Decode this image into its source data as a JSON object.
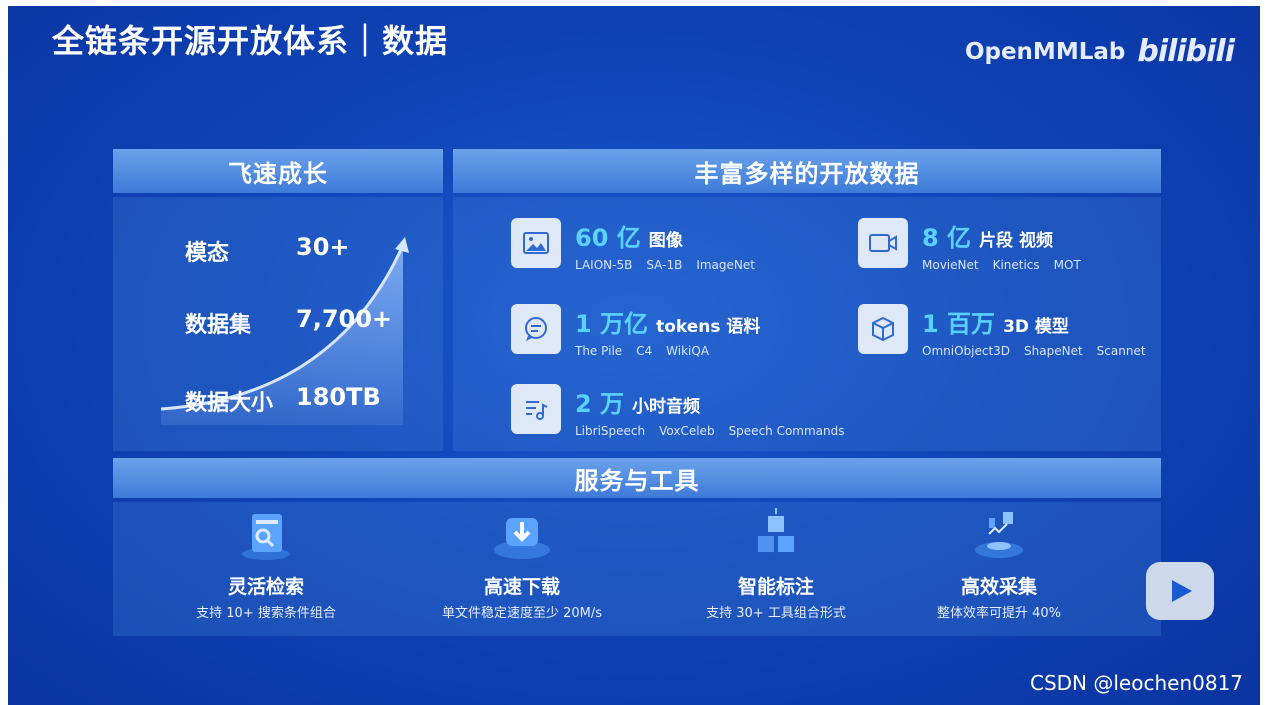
{
  "header": {
    "title": "全链条开源开放体系｜数据",
    "brand": "OpenMMLab",
    "bili_logo": "bilibili"
  },
  "growth": {
    "title": "飞速成长",
    "rows": [
      {
        "label": "模态",
        "value": "30+"
      },
      {
        "label": "数据集",
        "value": "7,700+"
      },
      {
        "label": "数据大小",
        "value": "180TB"
      }
    ]
  },
  "datasets": {
    "title": "丰富多样的开放数据",
    "items": [
      {
        "num": "60 亿",
        "label": "图像",
        "icon": "image-icon",
        "subs": [
          "LAION-5B",
          "SA-1B",
          "ImageNet"
        ]
      },
      {
        "num": "8 亿",
        "label": "片段 视频",
        "icon": "video-icon",
        "subs": [
          "MovieNet",
          "Kinetics",
          "MOT"
        ]
      },
      {
        "num": "1 万亿",
        "label": "tokens 语料",
        "icon": "chat-icon",
        "subs": [
          "The Pile",
          "C4",
          "WikiQA"
        ]
      },
      {
        "num": "1 百万",
        "label": "3D 模型",
        "icon": "cube-icon",
        "subs": [
          "OmniObject3D",
          "ShapeNet",
          "Scannet"
        ]
      },
      {
        "num": "2 万",
        "label": "小时音频",
        "icon": "music-icon",
        "subs": [
          "LibriSpeech",
          "VoxCeleb",
          "Speech Commands"
        ]
      }
    ]
  },
  "services": {
    "title": "服务与工具",
    "items": [
      {
        "title": "灵活检索",
        "sub": "支持 10+ 搜索条件组合",
        "icon": "search-panel-icon"
      },
      {
        "title": "高速下载",
        "sub": "单文件稳定速度至少 20M/s",
        "icon": "download-icon"
      },
      {
        "title": "智能标注",
        "sub": "支持 30+ 工具组合形式",
        "icon": "cubes-icon"
      },
      {
        "title": "高效采集",
        "sub": "整体效率可提升 40%",
        "icon": "collect-icon"
      }
    ]
  },
  "watermark": "CSDN @leochen0817",
  "colors": {
    "background": "#0f45b8",
    "accent": "#5ad2ff",
    "header_bar": "#4f8ce0"
  }
}
